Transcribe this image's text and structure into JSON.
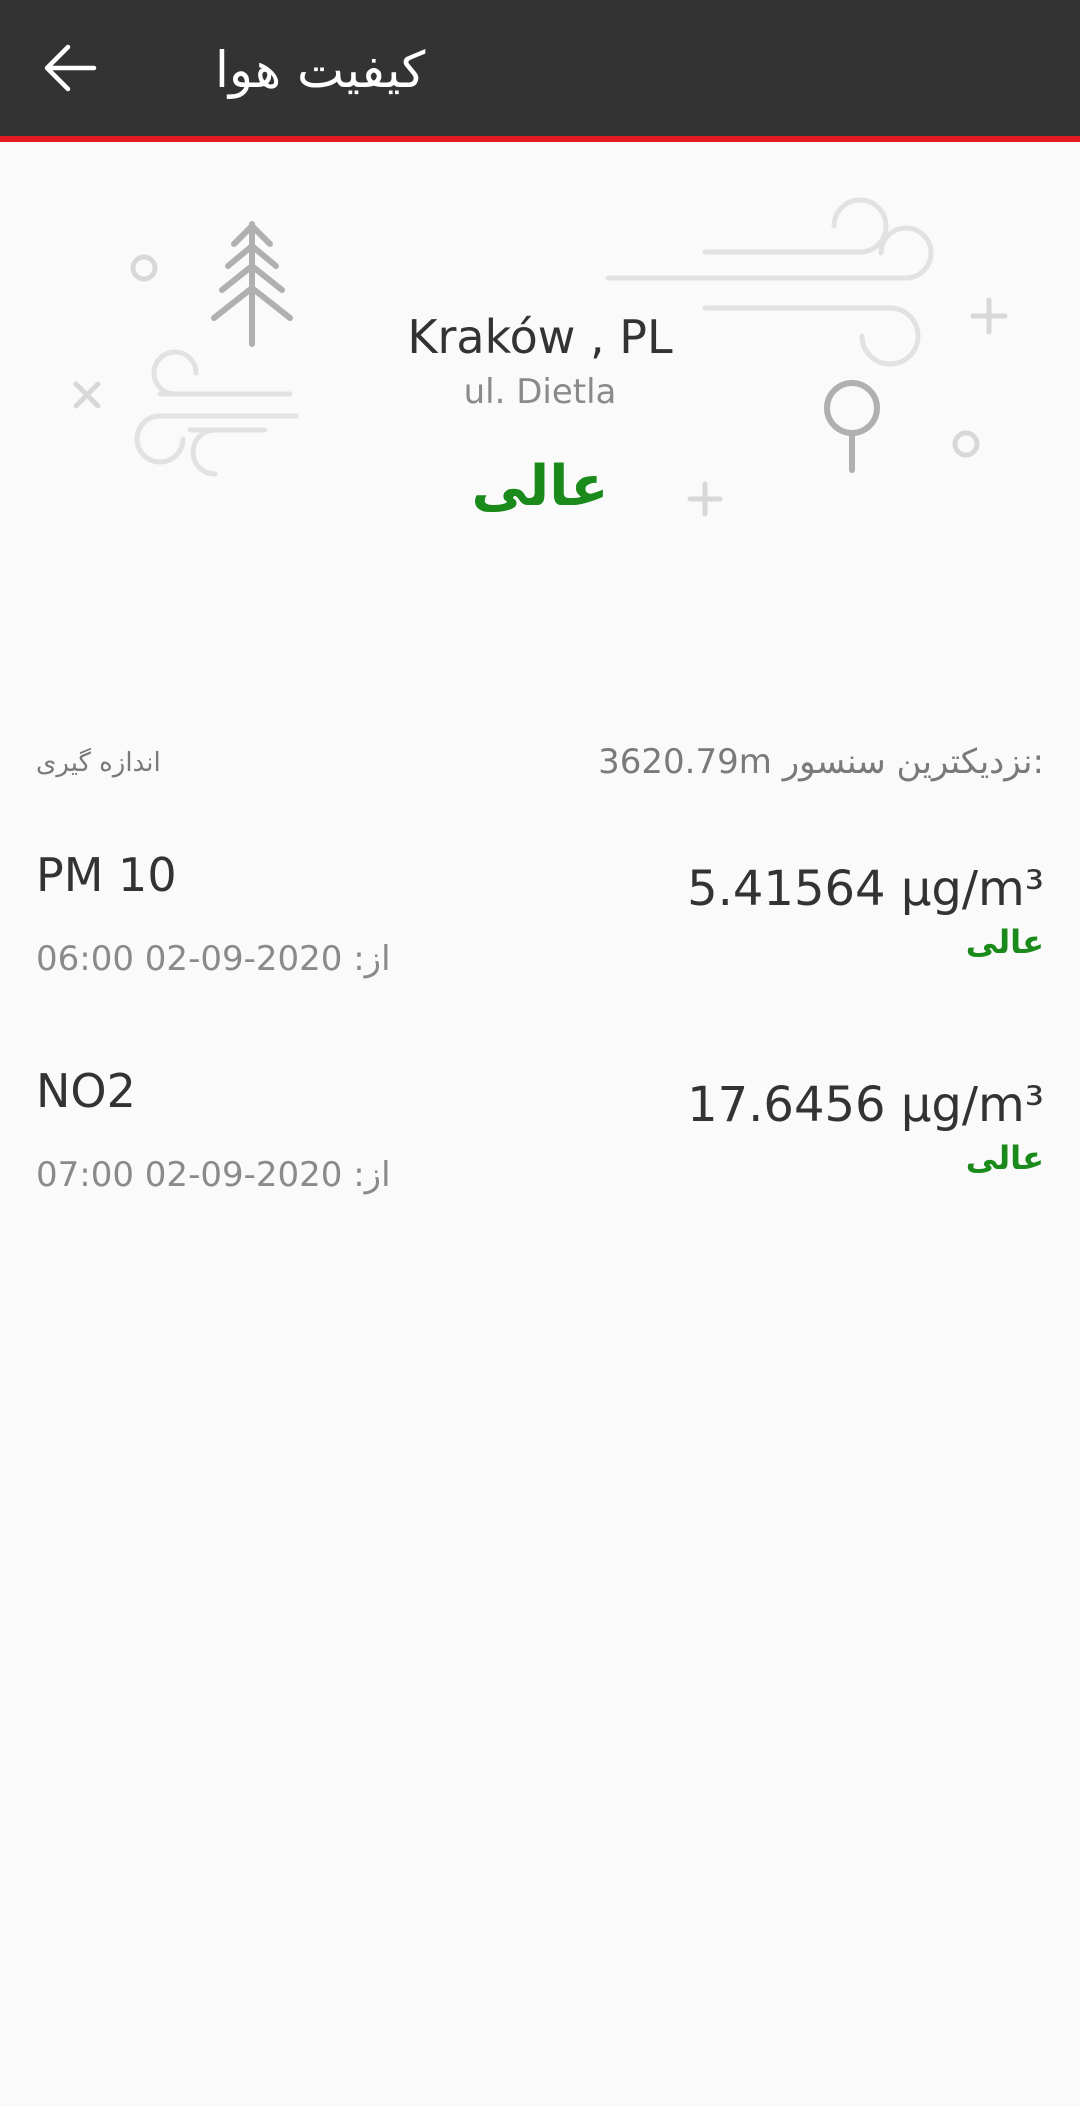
{
  "app_bar": {
    "title": "کیفیت هوا",
    "back_icon": "arrow-left-icon"
  },
  "colors": {
    "app_bar_bg": "#333333",
    "app_bar_accent": "#e31b23",
    "quality_good": "#1a8a1a"
  },
  "location": {
    "city": "Kraków , PL",
    "street": "ul. Dietla",
    "overall_quality": "عالی"
  },
  "meta": {
    "measurement_label": "اندازه گیری",
    "nearest_sensor": "3620.79m نزدیکترین سنسور:"
  },
  "readings": [
    {
      "name": "PM 10",
      "value": "5.41564 µg/m³",
      "quality": "عالی",
      "time": "از: 2020-09-02 06:00"
    },
    {
      "name": "NO2",
      "value": "17.6456 µg/m³",
      "quality": "عالی",
      "time": "از: 2020-09-02 07:00"
    }
  ]
}
